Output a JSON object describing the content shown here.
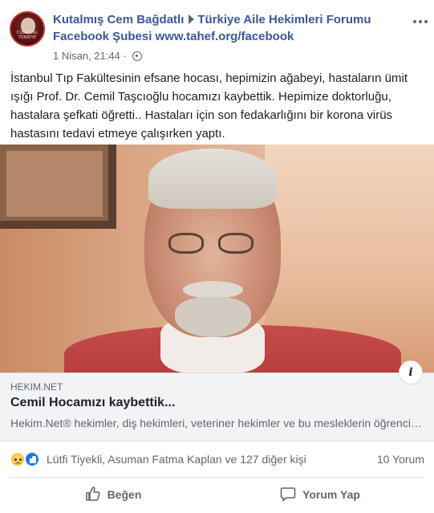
{
  "post": {
    "author": "Kutalmış Cem Bağdatlı",
    "group": "Türkiye Aile Hekimleri Forumu Facebook Şubesi www.tahef.org/facebook",
    "timestamp": "1 Nisan, 21:44",
    "privacy_icon": "globe-icon",
    "more_icon": "more-options-icon",
    "avatar_caption": "CUDE KAL TÜRKİYE",
    "text": "İstanbul Tıp Fakültesinin efsane hocası, hepimizin ağabeyi, hastaların ümit ışığı Prof. Dr. Cemil Taşcıoğlu hocamızı kaybettik. Hepimize doktorluğu, hastalara şefkati öğretti.. Hastaları için son fedakarlığını bir korona virüs hastasını tedavi etmeye çalışırken yaptı."
  },
  "link_preview": {
    "domain": "HEKIM.NET",
    "title": "Cemil Hocamızı kaybettik...",
    "description": "Hekim.Net® hekimler, diş hekimleri, veteriner hekimler ve bu mesleklerin öğrencilerine yönelik bir portaldır.",
    "info_glyph": "i"
  },
  "reactions": {
    "icons": [
      "sad-reaction-icon",
      "like-reaction-icon"
    ],
    "names": "Lütfi Tiyekli, Asuman Fatma Kaplan ve 127 diğer kişi",
    "comments": "10 Yorum"
  },
  "actions": {
    "like_label": "Beğen",
    "comment_label": "Yorum Yap"
  },
  "colors": {
    "link_blue": "#385898",
    "meta_gray": "#606770",
    "preview_bg": "#f2f3f5",
    "like_blue": "#1877f2"
  }
}
